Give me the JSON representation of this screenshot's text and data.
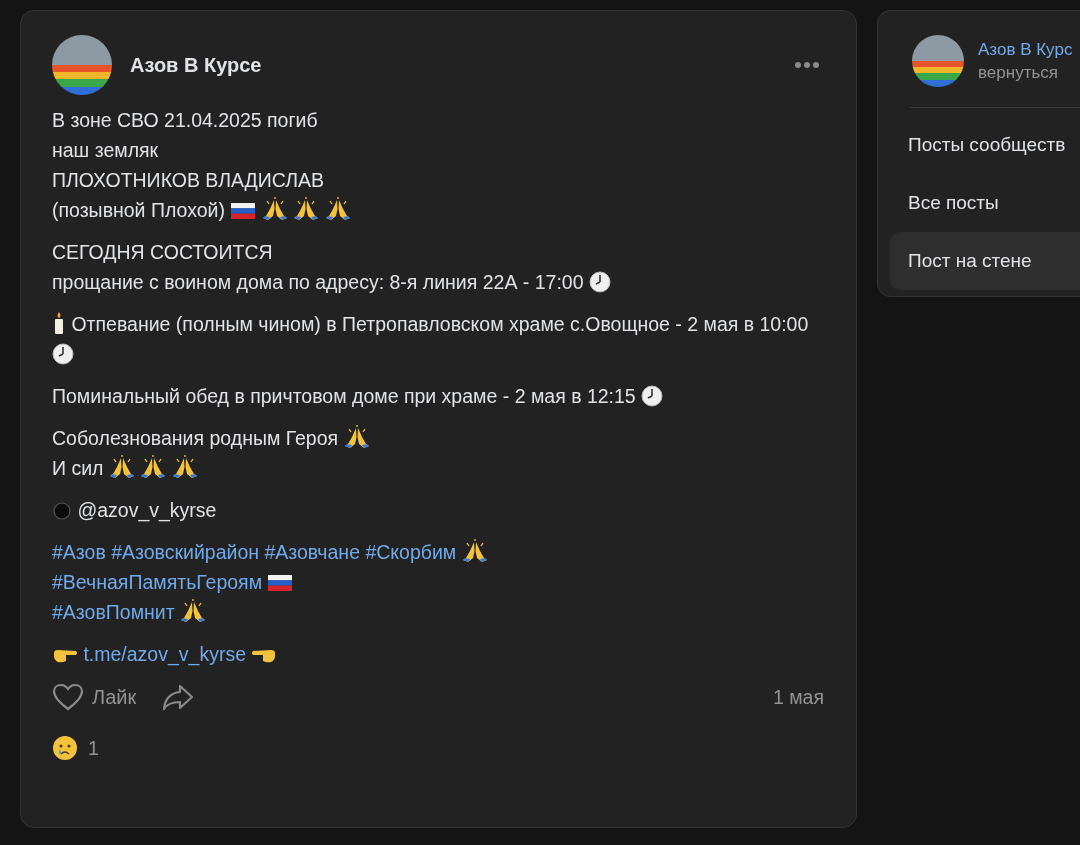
{
  "post": {
    "author": "Азов В Курсе",
    "paragraphs": [
      {
        "lines": [
          [
            {
              "kind": "text",
              "text": "В зоне СВО 21.04.2025 погиб"
            }
          ],
          [
            {
              "kind": "text",
              "text": "наш земляк"
            }
          ],
          [
            {
              "kind": "text",
              "text": "ПЛОХОТНИКОВ ВЛАДИСЛАВ"
            }
          ],
          [
            {
              "kind": "text",
              "text": "(позывной Плохой)"
            },
            {
              "kind": "flag"
            },
            {
              "kind": "pray"
            },
            {
              "kind": "pray"
            },
            {
              "kind": "pray"
            }
          ]
        ]
      },
      {
        "lines": [
          [
            {
              "kind": "text",
              "text": "СЕГОДНЯ СОСТОИТСЯ"
            }
          ],
          [
            {
              "kind": "text",
              "text": "прощание с воином дома по адресу: 8-я линия 22А - 17:00"
            },
            {
              "kind": "clock"
            }
          ]
        ]
      },
      {
        "lines": [
          [
            {
              "kind": "candle"
            },
            {
              "kind": "text",
              "text": "Отпевание (полным чином) в Петропавловском храме с.Овощное  - 2 мая в 10:00"
            },
            {
              "kind": "clock"
            }
          ]
        ]
      },
      {
        "lines": [
          [
            {
              "kind": "text",
              "text": "Поминальный обед в причтовом доме при храме - 2 мая в 12:15"
            },
            {
              "kind": "clock"
            }
          ]
        ]
      },
      {
        "lines": [
          [
            {
              "kind": "text",
              "text": "Соболезнования родным Героя"
            },
            {
              "kind": "pray"
            }
          ],
          [
            {
              "kind": "text",
              "text": "И сил"
            },
            {
              "kind": "pray"
            },
            {
              "kind": "pray"
            },
            {
              "kind": "pray"
            }
          ]
        ]
      },
      {
        "lines": [
          [
            {
              "kind": "dot"
            },
            {
              "kind": "text",
              "text": "@azov_v_kyrse"
            }
          ]
        ]
      },
      {
        "lines": [
          [
            {
              "kind": "hashtag",
              "text": "#Азов"
            },
            {
              "kind": "hashtag",
              "text": "#Азовскийрайон"
            },
            {
              "kind": "hashtag",
              "text": "#Азовчане"
            },
            {
              "kind": "hashtag",
              "text": "#Скорбим"
            },
            {
              "kind": "pray"
            }
          ],
          [
            {
              "kind": "hashtag",
              "text": "#ВечнаяПамятьГероям"
            },
            {
              "kind": "flag"
            }
          ],
          [
            {
              "kind": "hashtag",
              "text": "#АзовПомнит"
            },
            {
              "kind": "pray"
            }
          ]
        ]
      },
      {
        "lines": [
          [
            {
              "kind": "point_right"
            },
            {
              "kind": "link",
              "text": "t.me/azov_v_kyrse"
            },
            {
              "kind": "point_left"
            }
          ]
        ]
      }
    ],
    "like_label": "Лайк",
    "date": "1 мая",
    "reaction_count": "1"
  },
  "sidebar": {
    "group_name": "Азов В Курс",
    "subtitle": "вернуться",
    "items": [
      {
        "label": "Посты сообществ",
        "selected": false
      },
      {
        "label": "Все посты",
        "selected": false
      },
      {
        "label": "Пост на стене",
        "selected": true
      }
    ]
  }
}
